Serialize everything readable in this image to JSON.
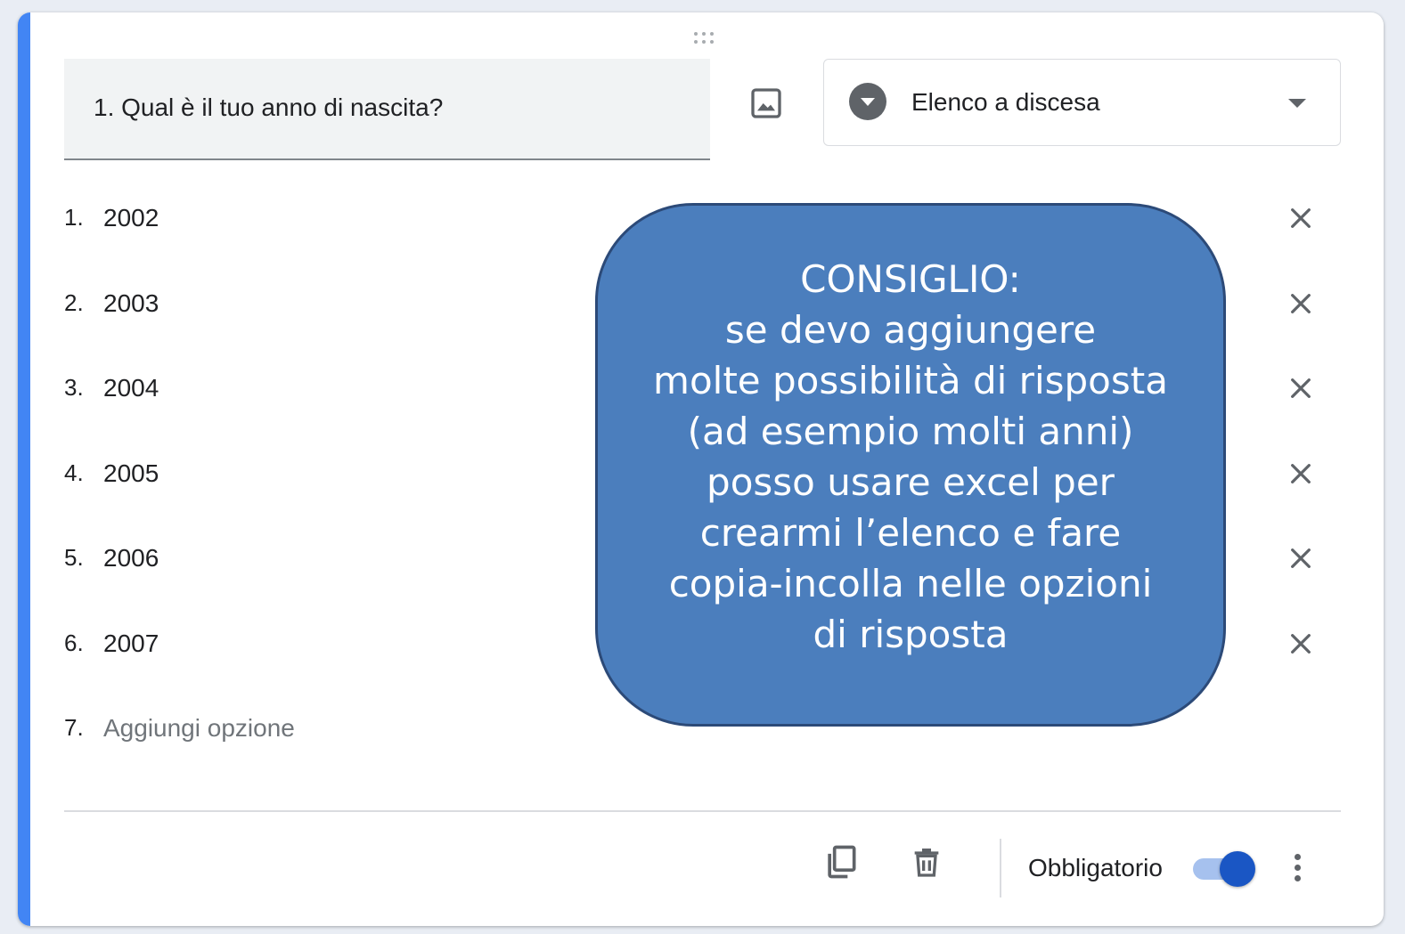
{
  "question": {
    "title": "1. Qual è il tuo anno di nascita?",
    "type_selected": "Elenco a discesa",
    "type_icon": "dropdown-circle-icon"
  },
  "options": [
    {
      "number": "1.",
      "label": "2002"
    },
    {
      "number": "2.",
      "label": "2003"
    },
    {
      "number": "3.",
      "label": "2004"
    },
    {
      "number": "4.",
      "label": "2005"
    },
    {
      "number": "5.",
      "label": "2006"
    },
    {
      "number": "6.",
      "label": "2007"
    }
  ],
  "add_option": {
    "number": "7.",
    "placeholder": "Aggiungi opzione"
  },
  "footer": {
    "required_label": "Obbligatorio",
    "required_on": true
  },
  "callout": {
    "text": "CONSIGLIO:\nse devo aggiungere\nmolte possibilità di risposta\n(ad esempio molti anni)\nposso usare excel per\ncrearmi l’elenco e fare\ncopia-incolla nelle opzioni\ndi risposta"
  },
  "colors": {
    "accent": "#4285f4",
    "callout_fill": "#4b7ebd",
    "callout_border": "#2c4a78",
    "toggle_on": "#1a56c4"
  }
}
